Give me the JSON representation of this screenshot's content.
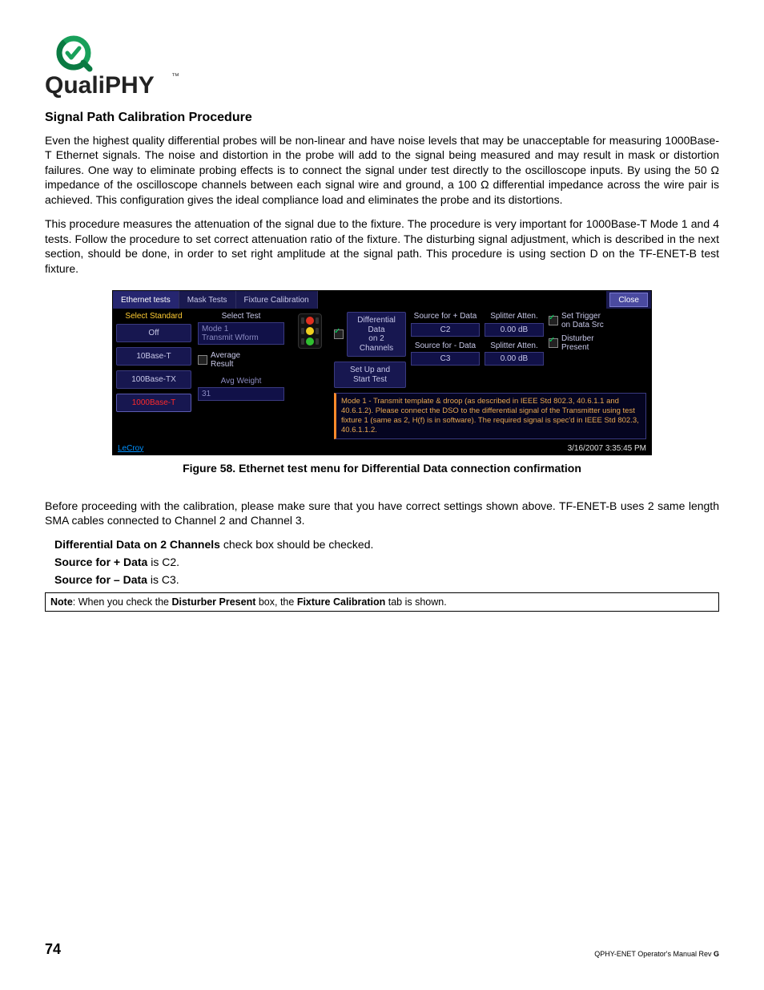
{
  "logo_text_quali": "Quali",
  "logo_text_phy": "PHY",
  "section_title": "Signal Path Calibration Procedure",
  "para1": "Even the highest quality differential probes will be non-linear and have noise levels that may be unacceptable for measuring 1000Base-T Ethernet signals. The noise and distortion in the probe will add to the signal being measured and may result in mask or distortion failures. One way to eliminate probing effects is to connect the signal under test directly to the oscilloscope inputs. By using the 50 Ω impedance of the oscilloscope channels between each signal wire and ground, a 100 Ω differential impedance across the wire pair is achieved. This configuration gives the ideal compliance load and eliminates the probe and its distortions.",
  "para2": "This procedure measures the attenuation of the signal due to the fixture. The procedure is very important for 1000Base-T Mode 1 and 4 tests. Follow the procedure to set correct attenuation ratio of the fixture. The disturbing signal adjustment, which is described in the next section, should be done, in order to set right amplitude at the signal path. This procedure is using section D on the TF-ENET-B test fixture.",
  "figure": {
    "tabs": {
      "ethernet": "Ethernet tests",
      "mask": "Mask Tests",
      "fixture": "Fixture Calibration",
      "close": "Close"
    },
    "left": {
      "header": "Select Standard",
      "off": "Off",
      "t10": "10Base-T",
      "tx100": "100Base-TX",
      "t1000": "1000Base-T"
    },
    "col2": {
      "select_test": "Select Test",
      "mode_val": "Mode 1",
      "transmit": "Transmit Wform",
      "avg_result": "Average\nResult",
      "avg_weight": "Avg Weight",
      "avg_weight_val": "31"
    },
    "right": {
      "diff2": "Differential Data\non 2 Channels",
      "setup": "Set Up and\nStart Test",
      "src_pos": "Source for + Data",
      "src_pos_val": "C2",
      "src_neg": "Source for - Data",
      "src_neg_val": "C3",
      "spl1": "Splitter Atten.",
      "spl1_val": "0.00 dB",
      "spl2": "Splitter Atten.",
      "spl2_val": "0.00 dB",
      "set_trigger": "Set Trigger\non Data Src",
      "disturber": "Disturber\nPresent",
      "msg": "Mode 1 - Transmit template & droop (as described in IEEE Std 802.3, 40.6.1.1 and 40.6.1.2). Please connect the DSO to the differential signal of the Transmitter using test fixture 1 (same as 2, H(f) is in software). The required signal is spec'd in IEEE Std 802.3, 40.6.1.1.2."
    },
    "status": {
      "brand": "LeCroy",
      "time": "3/16/2007 3:35:45 PM"
    }
  },
  "figure_caption": "Figure 58. Ethernet test menu for Differential Data connection confirmation",
  "para3": "Before proceeding with the calibration, please make sure that you have correct settings shown above. TF-ENET-B uses 2 same length SMA cables connected to Channel 2 and Channel 3.",
  "bullets": {
    "b1a": "Differential Data on 2 Channels",
    "b1b": " check box should be checked.",
    "b2a": "Source for + Data",
    "b2b": " is C2.",
    "b3a": "Source for – Data",
    "b3b": " is C3."
  },
  "note": {
    "prefix": "Note",
    "mid1": ": When you check the ",
    "bold1": "Disturber Present",
    "mid2": " box, the ",
    "bold2": "Fixture Calibration",
    "suffix": " tab is shown."
  },
  "footer": {
    "page": "74",
    "right_a": "QPHY-ENET Operator's Manual Rev ",
    "right_b": "G"
  }
}
